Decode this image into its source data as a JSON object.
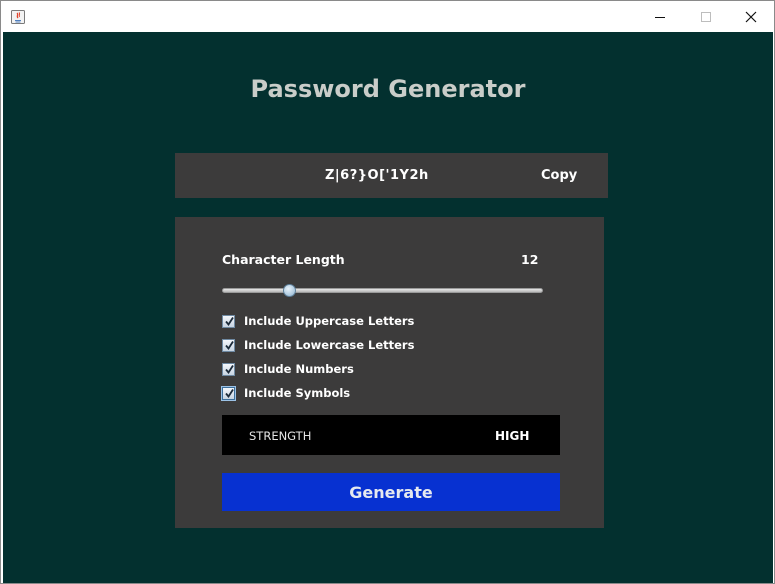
{
  "window": {
    "title": "",
    "controls": {
      "minimize": "minimize-icon",
      "maximize": "maximize-icon",
      "close": "close-icon"
    }
  },
  "app": {
    "title": "Password Generator",
    "password": "Z|6?}O['1Y2h",
    "copy_label": "Copy",
    "length_label": "Character Length",
    "length_value": "12",
    "slider": {
      "fraction": 0.198
    },
    "options": [
      {
        "label": "Include Uppercase Letters",
        "checked": true
      },
      {
        "label": "Include Lowercase Letters",
        "checked": true
      },
      {
        "label": "Include Numbers",
        "checked": true
      },
      {
        "label": "Include Symbols",
        "checked": true
      }
    ],
    "strength_label": "STRENGTH",
    "strength_value": "HIGH",
    "generate_label": "Generate"
  },
  "colors": {
    "background": "#03302f",
    "panel": "#3c3b3b",
    "strength_bg": "#000000",
    "button": "#0731d1",
    "title_text": "#c9cdc9"
  }
}
